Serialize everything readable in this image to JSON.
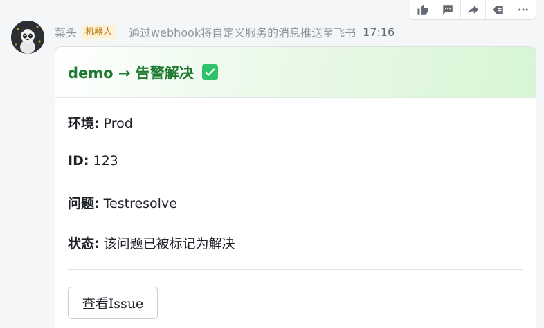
{
  "toolbar": {
    "icons": [
      "thumbs-up-icon",
      "comment-icon",
      "forward-icon",
      "delete-back-icon",
      "more-icon"
    ]
  },
  "message": {
    "sender": "菜头",
    "badge": "机器人",
    "description": "通过webhook将自定义服务的消息推送至飞书",
    "time": "17:16"
  },
  "card": {
    "title": "demo → 告警解决",
    "title_icon": "check-box-icon",
    "header_color": "#d7f5d4",
    "title_color": "#1f7a32",
    "fields": [
      {
        "label": "环境:",
        "value": " Prod"
      },
      {
        "label": "ID:",
        "value": " 123"
      },
      {
        "label": "问题:",
        "value": " Testresolve"
      },
      {
        "label": "状态:",
        "value": " 该问题已被标记为解决"
      }
    ],
    "button_label": "查看Issue"
  }
}
